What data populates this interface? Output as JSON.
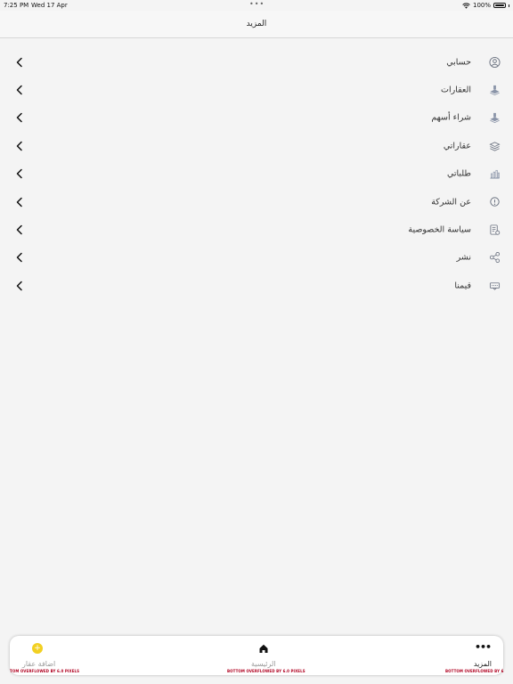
{
  "status_bar": {
    "time": "7:25 PM",
    "date": "Wed 17 Apr",
    "battery": "100%"
  },
  "header": {
    "title": "المزيد"
  },
  "menu": {
    "items": [
      {
        "label": "حسابي",
        "icon": "user-circle-icon"
      },
      {
        "label": "العقارات",
        "icon": "property-icon"
      },
      {
        "label": "شراء أسهم",
        "icon": "buy-shares-icon"
      },
      {
        "label": "عقاراتي",
        "icon": "my-properties-icon"
      },
      {
        "label": "طلباتي",
        "icon": "my-orders-chart-icon"
      },
      {
        "label": "عن الشركة",
        "icon": "info-icon"
      },
      {
        "label": "سياسة الخصوصية",
        "icon": "privacy-policy-icon"
      },
      {
        "label": "نشر",
        "icon": "share-icon"
      },
      {
        "label": "قيمنا",
        "icon": "rate-icon"
      }
    ]
  },
  "tab_bar": {
    "add_label": "اضافة عقار",
    "home_label": "الرئيسية",
    "more_label": "المزيد",
    "add_overflow": "TOM OVERFLOWED BY 6.0 PIXELS",
    "home_overflow": "BOTTOM OVERFLOWED BY 6.0 PIXELS",
    "more_overflow": "BOTTOM OVERFLOWED BY 6"
  },
  "colors": {
    "background": "#f4f4f4",
    "accent": "#f2d022",
    "icon": "#7f8aa0",
    "overflow_text": "#b00020"
  }
}
